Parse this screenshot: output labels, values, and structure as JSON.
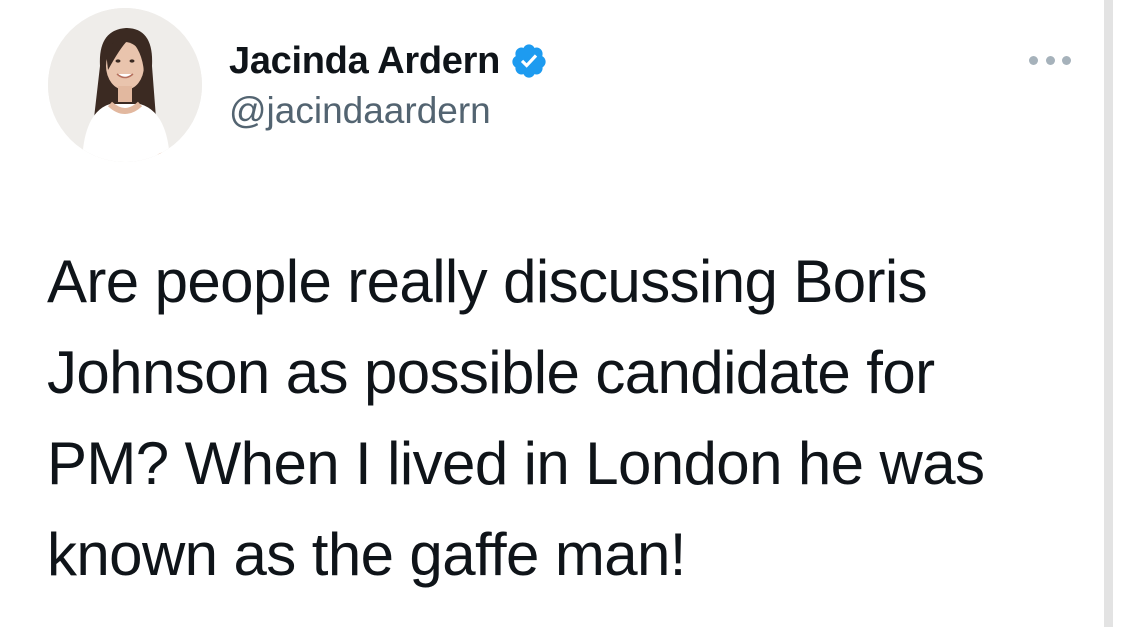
{
  "tweet": {
    "author": {
      "display_name": "Jacinda Ardern",
      "handle": "@jacindaardern",
      "verified": true,
      "avatar_icon": "profile-photo"
    },
    "more_icon": "more-options-icon",
    "text_lines": [
      "Are people really discussing Boris",
      "Johnson as possible candidate for",
      "PM? When I lived in London he was",
      "known as the gaffe man!"
    ]
  },
  "colors": {
    "text_primary": "#0f1419",
    "text_secondary": "#536471",
    "verified_blue": "#1d9bf0"
  }
}
